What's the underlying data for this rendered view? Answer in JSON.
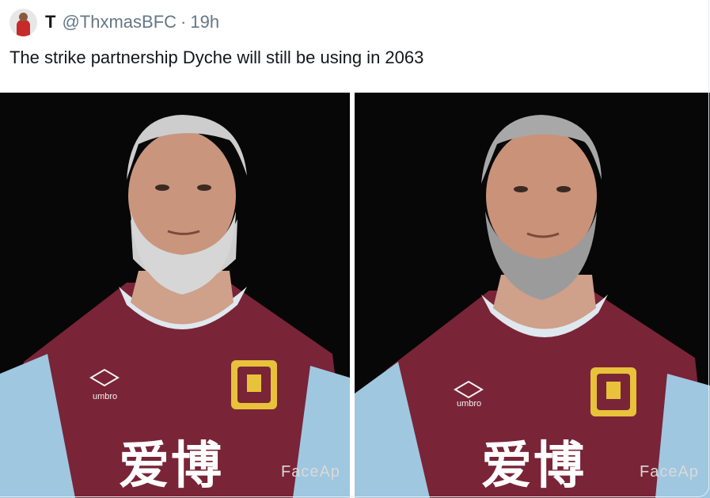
{
  "tweet": {
    "display_name": "T",
    "handle": "@ThxmasBFC",
    "separator": "·",
    "time": "19h",
    "text": "The strike partnership Dyche will still be using in 2063"
  },
  "photos": [
    {
      "sponsor_text": "爱博",
      "kit_brand": "umbro",
      "watermark": "FaceAp"
    },
    {
      "sponsor_text": "爱博",
      "kit_brand": "umbro",
      "watermark": "FaceAp"
    }
  ],
  "colors": {
    "claret": "#7a2437",
    "sky_blue": "#9fc7e0",
    "text": "#14171a",
    "muted": "#657786"
  }
}
